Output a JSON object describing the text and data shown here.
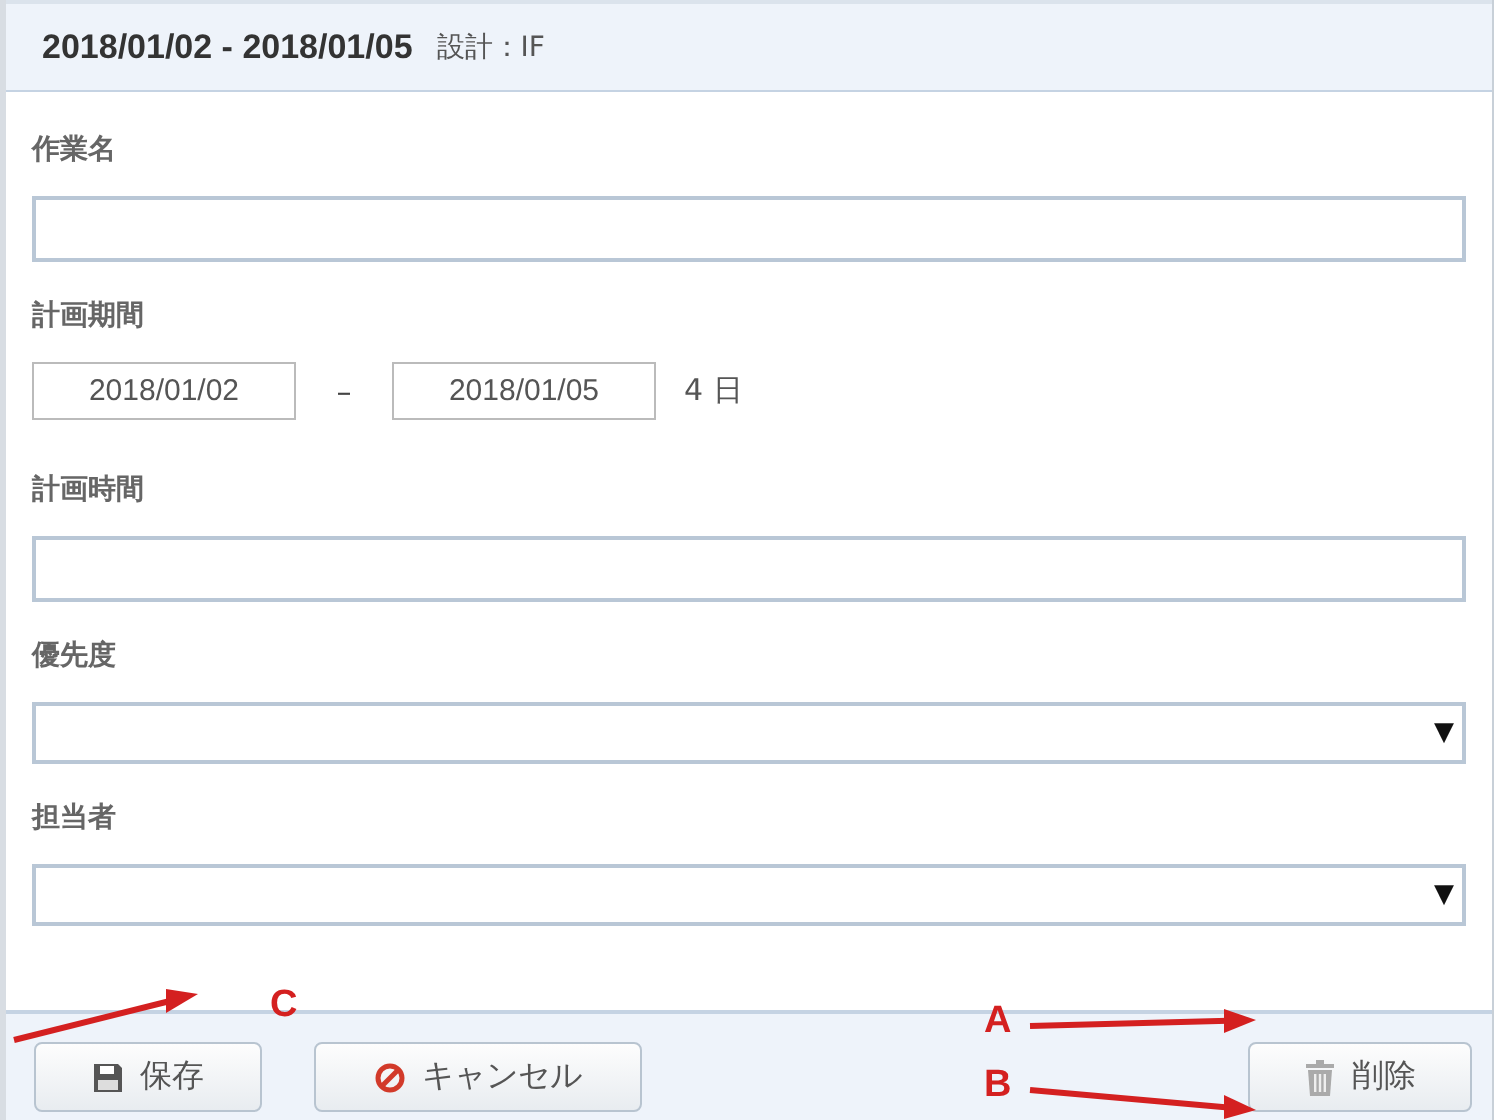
{
  "header": {
    "title": "2018/01/02 - 2018/01/05",
    "subtitle": "設計：IF"
  },
  "fields": [
    {
      "kind": "text",
      "label": "作業名"
    },
    {
      "kind": "daterange",
      "label": "計画期間",
      "start": "2018/01/02",
      "separator": "–",
      "end": "2018/01/05",
      "days": "4 日"
    },
    {
      "kind": "text",
      "label": "計画時間"
    },
    {
      "kind": "select",
      "label": "優先度",
      "arrow": "▼"
    },
    {
      "kind": "select",
      "label": "担当者",
      "arrow": "▼"
    }
  ],
  "buttons": [
    {
      "kind": "save",
      "label": "保存"
    },
    {
      "kind": "cancel",
      "label": "キャンセル"
    },
    {
      "kind": "delete",
      "label": "削除"
    }
  ],
  "annotations": [
    {
      "label": "C"
    },
    {
      "label": "A"
    },
    {
      "label": "B"
    }
  ]
}
